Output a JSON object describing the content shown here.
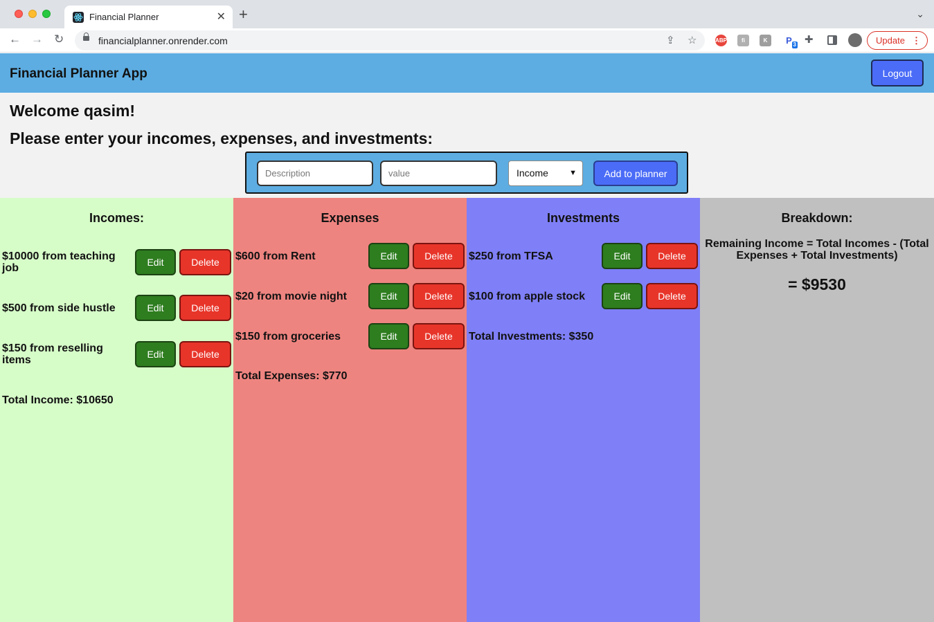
{
  "browser": {
    "tab_title": "Financial Planner",
    "url": "financialplanner.onrender.com",
    "update_label": "Update"
  },
  "app": {
    "title": "Financial Planner App",
    "logout_label": "Logout",
    "welcome": "Welcome qasim!",
    "prompt": "Please enter your incomes, expenses, and investments:"
  },
  "form": {
    "description_placeholder": "Description",
    "value_placeholder": "value",
    "type_selected": "Income",
    "add_label": "Add to planner"
  },
  "buttons": {
    "edit": "Edit",
    "delete": "Delete"
  },
  "incomes": {
    "title": "Incomes:",
    "items": [
      {
        "text": "$10000 from teaching job"
      },
      {
        "text": "$500 from side hustle"
      },
      {
        "text": "$150 from reselling items"
      }
    ],
    "total": "Total Income: $10650"
  },
  "expenses": {
    "title": "Expenses",
    "items": [
      {
        "text": "$600 from Rent"
      },
      {
        "text": "$20 from movie night"
      },
      {
        "text": "$150 from groceries"
      }
    ],
    "total": "Total Expenses: $770"
  },
  "investments": {
    "title": "Investments",
    "items": [
      {
        "text": "$250 from TFSA"
      },
      {
        "text": "$100 from apple stock"
      }
    ],
    "total": "Total Investments: $350"
  },
  "breakdown": {
    "title": "Breakdown:",
    "formula": "Remaining Income = Total Incomes - (Total Expenses + Total Investments)",
    "result": "= $9530"
  }
}
